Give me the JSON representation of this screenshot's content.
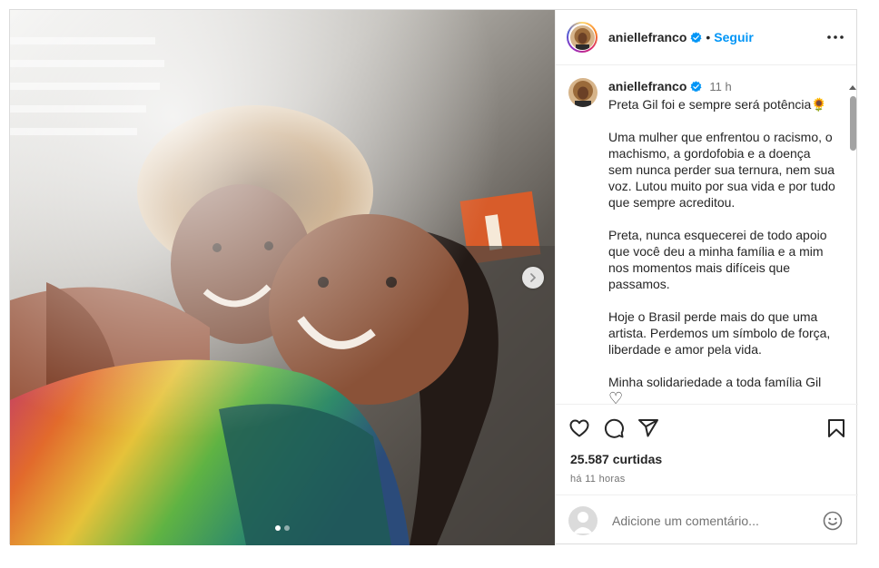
{
  "header": {
    "username": "aniellefranco",
    "separator": "•",
    "follow_label": "Seguir"
  },
  "caption": {
    "username": "aniellefranco",
    "time": "11 h",
    "text": "Preta Gil foi e sempre será potência",
    "emoji": "🌻",
    "text_rest": "\n\nUma mulher que enfrentou o racismo, o machismo, a gordofobia e a doença sem nunca perder sua ternura, nem sua voz. Lutou muito por sua vida e por tudo que sempre acreditou.\n\nPreta, nunca esquecerei de todo apoio que você deu a minha família e a mim nos momentos mais difíceis que passamos.\n\nHoje o Brasil perde mais do que uma artista. Perdemos um símbolo de força, liberdade e amor pela vida.\n\nMinha solidariedade a toda família Gil",
    "heart": "♡"
  },
  "media": {
    "slide_count": 2,
    "active_slide": 1
  },
  "stats": {
    "likes": "25.587 curtidas",
    "posted": "há 11 horas"
  },
  "comment": {
    "placeholder": "Adicione um comentário..."
  },
  "icons": {
    "verified": "verified-badge-icon",
    "more": "more-options-icon",
    "like": "heart-icon",
    "comment": "comment-icon",
    "share": "share-icon",
    "save": "bookmark-icon",
    "emoji": "emoji-icon",
    "next": "chevron-right-icon"
  },
  "colors": {
    "accent": "#0095f6",
    "text": "#262626",
    "muted": "#737373",
    "border": "#dbdbdb"
  }
}
